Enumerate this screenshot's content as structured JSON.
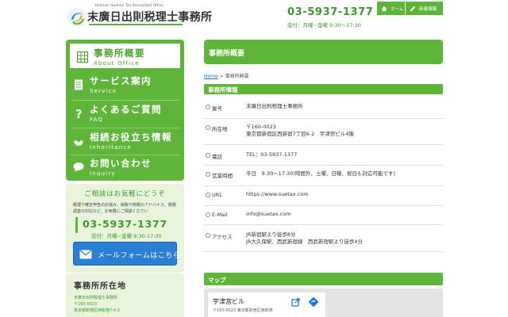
{
  "header": {
    "logo_sub": "Hidenori Suehiro Tax Accountant Office",
    "logo_title": "末廣日出則税理士事務所",
    "phone": "03-5937-1377",
    "hours": "受付：月曜~金曜 9:30〜17:30",
    "nav": [
      {
        "label": "ホーム",
        "icon": "home-icon"
      },
      {
        "label": "新着情報",
        "icon": "pencil-icon"
      }
    ]
  },
  "sidebar": {
    "menu": [
      {
        "main": "事務所概要",
        "sub": "About Office",
        "icon": "grid-icon",
        "active": true
      },
      {
        "main": "サービス案内",
        "sub": "Service",
        "icon": "document-icon",
        "active": false
      },
      {
        "main": "よくあるご質問",
        "sub": "FAQ",
        "icon": "question-icon",
        "active": false
      },
      {
        "main": "相続お役立ち情報",
        "sub": "Inheritance",
        "icon": "hands-icon",
        "active": false
      },
      {
        "main": "お問い合わせ",
        "sub": "Inquiry",
        "icon": "chat-icon",
        "active": false
      }
    ],
    "contact": {
      "title": "ご相談はお気軽にどうぞ",
      "desc": "経理や確定申告のお悩み、納税や節税のアドバイス、税務調査の対応など、お気軽にご相談ください",
      "phone": "03-5937-1377",
      "hours": "受付：月曜~金曜 9:30-17:30",
      "mail_button": "メールフォームはこちら"
    },
    "location": {
      "title": "事務所所在地",
      "lines": [
        "末廣日出則税理士事務所",
        "〒160-0023",
        "東京都新宿区西新宿7-6-2"
      ]
    }
  },
  "main": {
    "page_title": "事務所概要",
    "breadcrumb": {
      "home": "Home",
      "sep": " > ",
      "current": "事務所概要"
    },
    "section_title": "事務所情報",
    "rows": [
      {
        "label": "屋号",
        "lines": [
          "末廣日出則税理士事務所"
        ]
      },
      {
        "label": "所在地",
        "lines": [
          "〒160-0023",
          "東京都新宿区西新宿7丁目6-2　宇津宮ビル4階"
        ]
      },
      {
        "label": "電話",
        "lines": [
          "TEL：03-5937-1377"
        ]
      },
      {
        "label": "営業時間",
        "lines": [
          "平日　9:30〜17:30(時間外、土曜、日曜、祝日も対応可能です)"
        ]
      },
      {
        "label": "URL",
        "lines": [
          "https://www.suetax.com"
        ]
      },
      {
        "label": "E-Mail",
        "lines": [
          "info@suetax.com"
        ]
      },
      {
        "label": "アクセス",
        "lines": [
          "JR新宿駅より徒歩8分",
          "JR大久保駅、西武新宿線　西武新宿駅より徒歩4分"
        ]
      }
    ],
    "map_title": "マップ",
    "map_card": {
      "name": "宇津宮ビル",
      "address": "〒160-0023 東京都新宿区西新宿"
    }
  },
  "colors": {
    "accent": "#5fb53a",
    "accent_dark": "#3a9a2a",
    "pale": "#e8f5dc",
    "button_blue": "#2a7fd4"
  }
}
